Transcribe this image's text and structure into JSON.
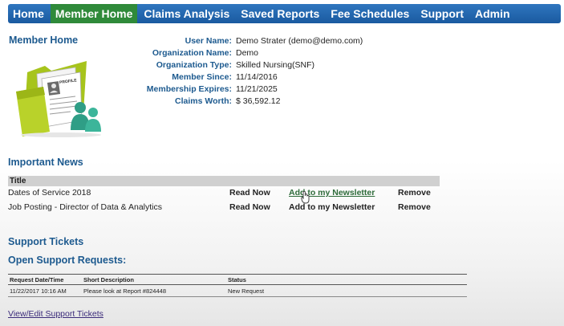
{
  "nav": {
    "items": [
      {
        "label": "Home"
      },
      {
        "label": "Member Home"
      },
      {
        "label": "Claims Analysis"
      },
      {
        "label": "Saved Reports"
      },
      {
        "label": "Fee Schedules"
      },
      {
        "label": "Support"
      },
      {
        "label": "Admin"
      }
    ],
    "active_color": "#2f8a3a",
    "bar_color": "#1f63a8"
  },
  "member": {
    "heading": "Member Home",
    "image_icon": "profile-folder-icon",
    "folder_label": "PROFILE",
    "fields": [
      {
        "label": "User Name:",
        "value": "Demo Strater (demo@demo.com)"
      },
      {
        "label": "Organization Name:",
        "value": "Demo"
      },
      {
        "label": "Organization Type:",
        "value": "Skilled Nursing(SNF)"
      },
      {
        "label": "Member Since:",
        "value": "11/14/2016"
      },
      {
        "label": "Membership Expires:",
        "value": "11/21/2025"
      },
      {
        "label": "Claims Worth:",
        "value": "$ 36,592.12"
      }
    ]
  },
  "news": {
    "heading": "Important News",
    "column_title": "Title",
    "rows": [
      {
        "title": "Dates of Service 2018",
        "read": "Read Now",
        "add": "Add to my Newsletter",
        "remove": "Remove"
      },
      {
        "title": "Job Posting - Director of Data & Analytics",
        "read": "Read Now",
        "add": "Add to my Newsletter",
        "remove": "Remove"
      }
    ]
  },
  "support": {
    "heading": "Support Tickets",
    "subheading": "Open Support Requests:",
    "columns": [
      "Request Date/Time",
      "Short Description",
      "Status"
    ],
    "rows": [
      {
        "date": "11/22/2017 10:16 AM",
        "desc": "Please look at Report #824448",
        "status": "New Request"
      }
    ],
    "link": "View/Edit Support Tickets"
  }
}
